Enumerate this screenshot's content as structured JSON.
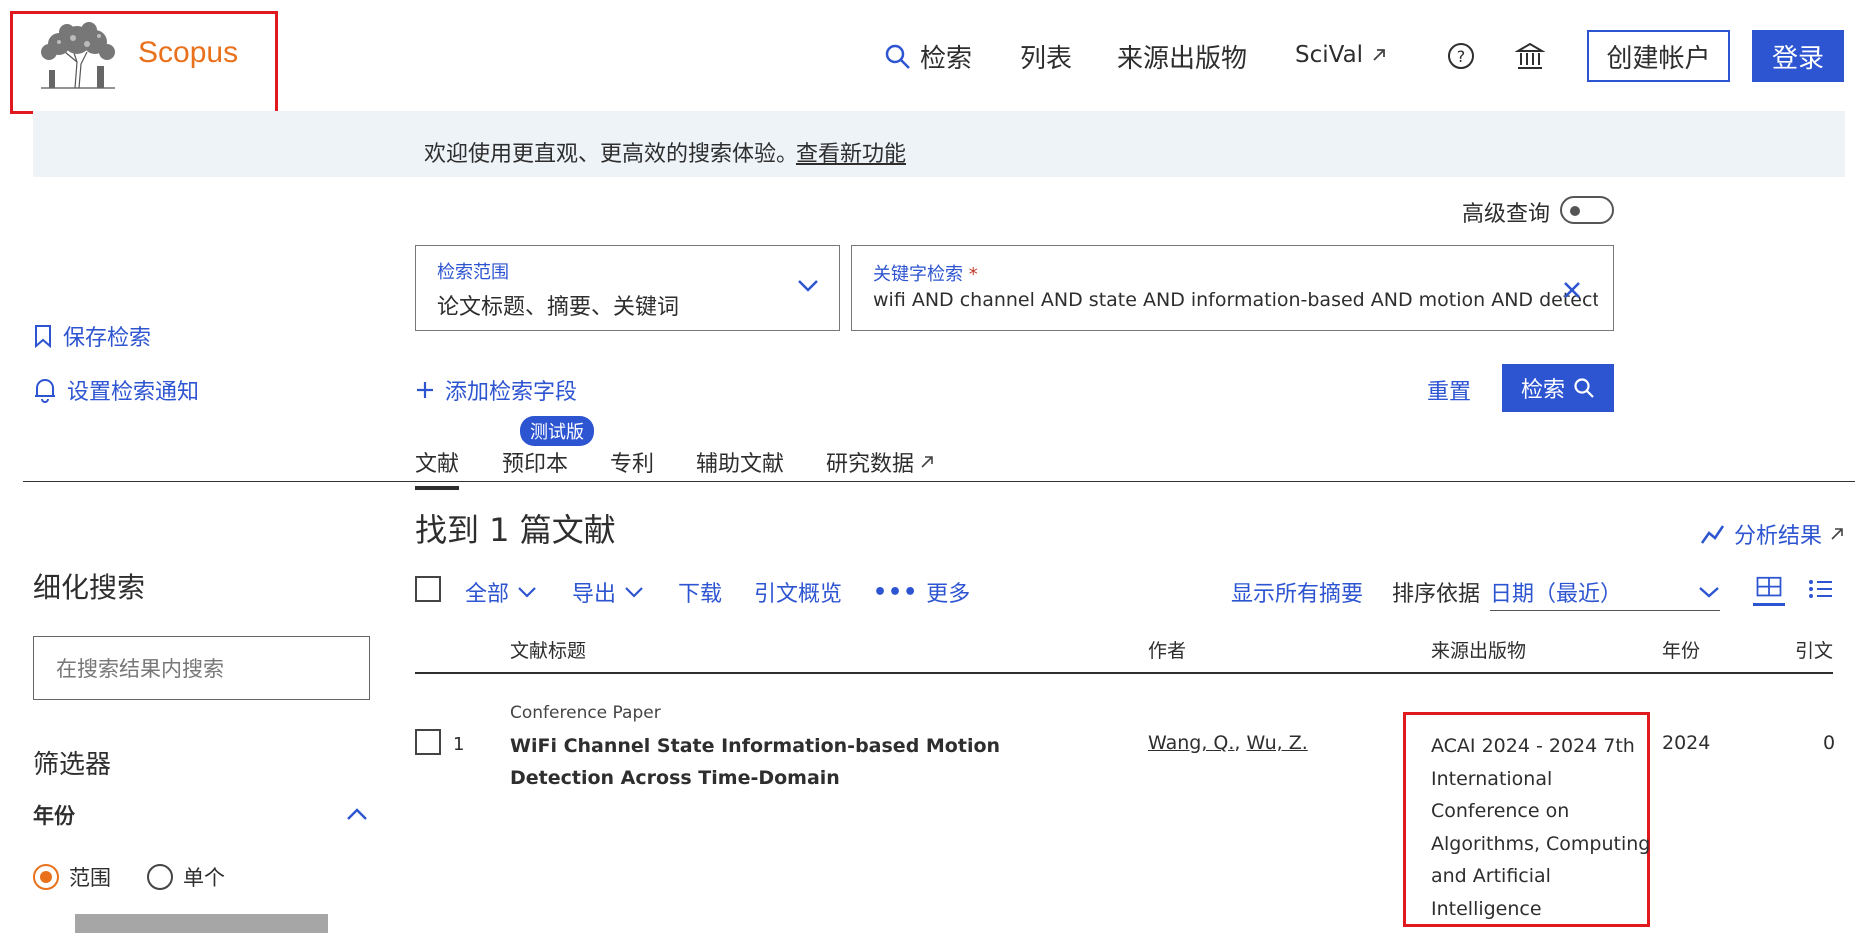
{
  "header": {
    "logo_text": "Scopus",
    "nav": [
      {
        "label": "检索",
        "icon": "search-icon"
      },
      {
        "label": "列表"
      },
      {
        "label": "来源出版物"
      },
      {
        "label": "SciVal",
        "icon": "external-link-icon"
      }
    ],
    "create_account": "创建帐户",
    "login": "登录"
  },
  "banner": {
    "text": "欢迎使用更直观、更高效的搜索体验。",
    "link": "查看新功能"
  },
  "search": {
    "advanced_label": "高级查询",
    "scope_label": "检索范围",
    "scope_value": "论文标题、摘要、关键词",
    "keyword_label": "关键字检索",
    "required_mark": "*",
    "keyword_value": "wifi AND channel AND state AND information-based AND motion AND detection AND",
    "add_field": "添加检索字段",
    "reset": "重置",
    "search_button": "检索"
  },
  "sidebar": {
    "save_search": "保存检索",
    "set_alert": "设置检索通知",
    "refine_title": "细化搜索",
    "refine_placeholder": "在搜索结果内搜索",
    "filters_title": "筛选器",
    "year_title": "年份",
    "range_label": "范围",
    "single_label": "单个"
  },
  "tabs": {
    "beta": "测试版",
    "items": [
      "文献",
      "预印本",
      "专利",
      "辅助文献",
      "研究数据"
    ]
  },
  "results": {
    "title": "找到 1 篇文献",
    "analyze": "分析结果",
    "toolbar": {
      "all": "全部",
      "export": "导出",
      "download": "下载",
      "citation_overview": "引文概览",
      "more": "更多",
      "show_abstracts": "显示所有摘要",
      "sort_label": "排序依据",
      "sort_value": "日期（最近）"
    },
    "columns": [
      "文献标题",
      "作者",
      "来源出版物",
      "年份",
      "引文"
    ],
    "rows": [
      {
        "index": "1",
        "doc_type": "Conference Paper",
        "title": "WiFi Channel State Information-based Motion Detection Across Time-Domain",
        "author1": "Wang, Q.",
        "author2": "Wu, Z.",
        "source": "ACAI 2024 - 2024 7th International Conference on Algorithms, Computing and Artificial Intelligence",
        "year": "2024",
        "citations": "0"
      }
    ]
  },
  "colors": {
    "accent": "#2e55d1",
    "brand_orange": "#e9711c",
    "highlight_red": "#e0191f"
  }
}
